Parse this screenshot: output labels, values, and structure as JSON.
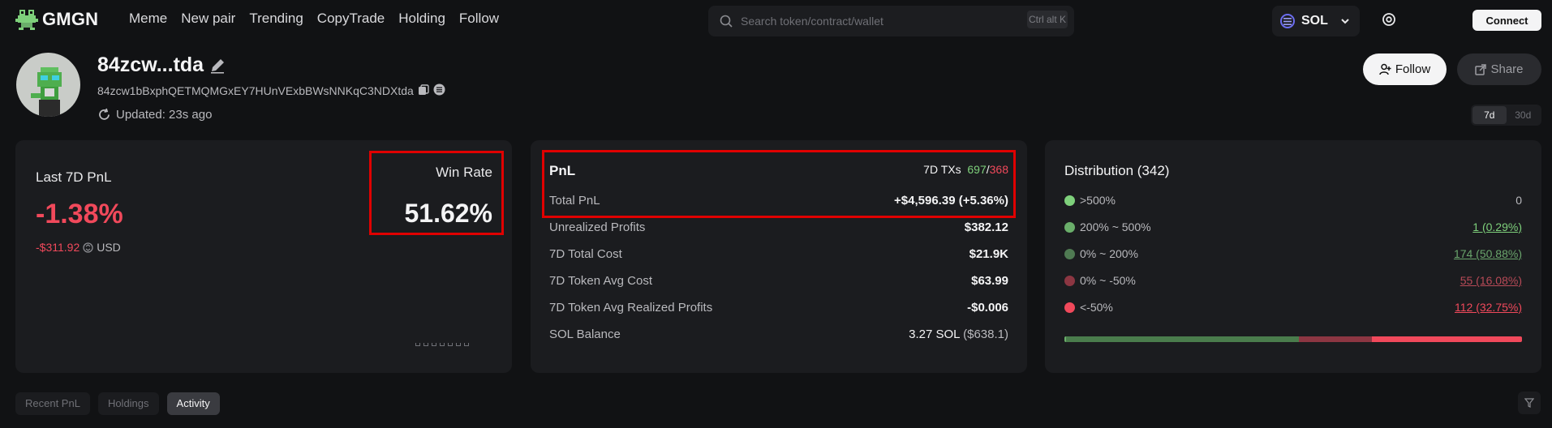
{
  "brand": "GMGN",
  "nav": [
    "Meme",
    "New pair",
    "Trending",
    "CopyTrade",
    "Holding",
    "Follow"
  ],
  "search": {
    "placeholder": "Search token/contract/wallet",
    "shortcut": "Ctrl alt K"
  },
  "chain": "SOL",
  "connect": "Connect",
  "profile": {
    "name": "84zcw...tda",
    "address": "84zcw1bBxphQETMQMGxEY7HUnVExbBWsNNKqC3NDXtda",
    "updated": "Updated: 23s ago",
    "follow": "Follow",
    "share": "Share",
    "periods": [
      "7d",
      "30d"
    ],
    "active_period": "7d"
  },
  "pnl_card": {
    "title": "Last 7D PnL",
    "percent": "-1.38%",
    "usd_value": "-$311.92",
    "currency": "USD",
    "win_rate_label": "Win Rate",
    "win_rate": "51.62%"
  },
  "stats_card": {
    "title": "PnL",
    "tx_label": "7D TXs",
    "tx_buys": "697",
    "tx_sep": "/",
    "tx_sells": "368",
    "total_label": "Total PnL",
    "total_value": "+$4,596.39 (+5.36%)",
    "rows": [
      {
        "label": "Unrealized Profits",
        "value": "$382.12",
        "tone": "g"
      },
      {
        "label": "7D Total Cost",
        "value": "$21.9K",
        "tone": ""
      },
      {
        "label": "7D Token Avg Cost",
        "value": "$63.99",
        "tone": ""
      },
      {
        "label": "7D Token Avg Realized Profits",
        "value": "-$0.006",
        "tone": "r"
      }
    ],
    "sol_label": "SOL Balance",
    "sol_value": "3.27 SOL",
    "sol_usd": "($638.1)"
  },
  "distribution": {
    "title": "Distribution (342)",
    "rows": [
      {
        "label": ">500%",
        "count": "0",
        "color": "#7ed07b",
        "text_color": "#b9b9bd"
      },
      {
        "label": "200% ~ 500%",
        "count": "1 (0.29%)",
        "color": "#6aae6a",
        "text_color": "#7ed07b"
      },
      {
        "label": "0% ~ 200%",
        "count": "174 (50.88%)",
        "color": "#4f7a52",
        "text_color": "#6aa56c"
      },
      {
        "label": "0% ~ -50%",
        "count": "55 (16.08%)",
        "color": "#8c3642",
        "text_color": "#b84a57"
      },
      {
        "label": "<-50%",
        "count": "112 (32.75%)",
        "color": "#f1495b",
        "text_color": "#f1495b"
      }
    ],
    "bar": [
      {
        "share": 0.29,
        "color": "#6aae6a"
      },
      {
        "share": 50.88,
        "color": "#4a7c4c"
      },
      {
        "share": 16.08,
        "color": "#8c3642"
      },
      {
        "share": 32.75,
        "color": "#f1495b"
      }
    ]
  },
  "tabs": [
    "Recent PnL",
    "Holdings",
    "Activity"
  ],
  "active_tab": "Activity"
}
